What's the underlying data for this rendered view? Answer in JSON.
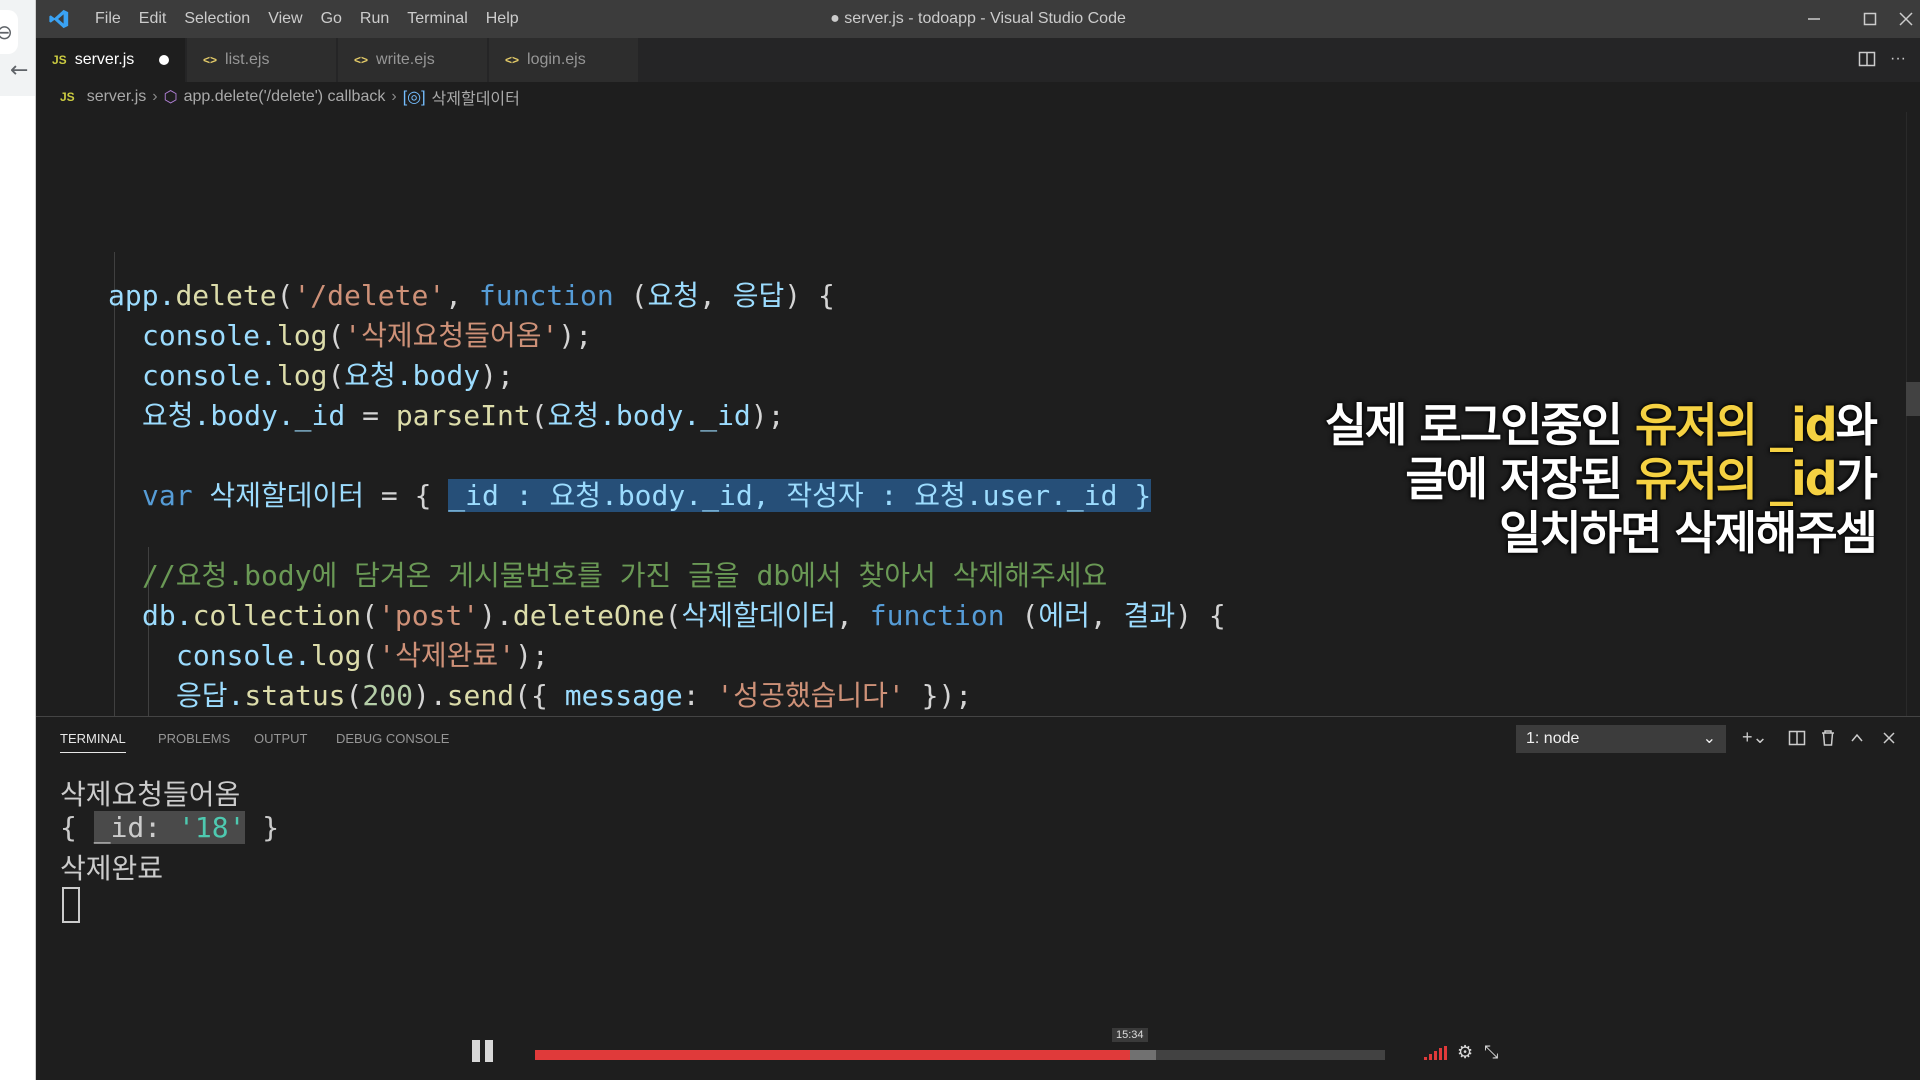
{
  "window": {
    "title": "● server.js - todoapp - Visual Studio Code",
    "menu": [
      "File",
      "Edit",
      "Selection",
      "View",
      "Go",
      "Run",
      "Terminal",
      "Help"
    ]
  },
  "tabs": [
    {
      "label": "server.js",
      "icon": "JS",
      "active": true,
      "dirty": true
    },
    {
      "label": "list.ejs",
      "icon": "<>",
      "active": false
    },
    {
      "label": "write.ejs",
      "icon": "<>",
      "active": false
    },
    {
      "label": "login.ejs",
      "icon": "<>",
      "active": false
    }
  ],
  "breadcrumbs": {
    "file_icon": "JS",
    "file": "server.js",
    "callback": "app.delete('/delete') callback",
    "variable": "삭제할데이터"
  },
  "code": {
    "l1": {
      "a": "app.",
      "b": "delete",
      "c": "(",
      "d": "'/delete'",
      "e": ", ",
      "f": "function",
      "g": " (",
      "h": "요청",
      "i": ", ",
      "j": "응답",
      "k": ") {"
    },
    "l2": {
      "a": "console.",
      "b": "log",
      "c": "(",
      "d": "'삭제요청들어옴'",
      "e": ");"
    },
    "l3": {
      "a": "console.",
      "b": "log",
      "c": "(",
      "d": "요청.body",
      "e": ");"
    },
    "l4": {
      "a": "요청.body._id",
      "b": " = ",
      "c": "parseInt",
      "d": "(",
      "e": "요청.body._id",
      "f": ");"
    },
    "l5": {
      "a": "var",
      "b": " 삭제할데이터",
      "c": " = { ",
      "d": "_id : 요청.body._id, 작성자 : 요청.user._id }"
    },
    "l6": {
      "a": "//요청.body에 담겨온 게시물번호를 가진 글을 db에서 찾아서 삭제해주세요"
    },
    "l7": {
      "a": "db.",
      "b": "collection",
      "c": "(",
      "d": "'post'",
      "e": ").",
      "f": "deleteOne",
      "g": "(",
      "h": "삭제할데이터",
      "i": ", ",
      "j": "function",
      "k": " (",
      "l": "에러",
      "m": ", ",
      "n": "결과",
      "o": ") {"
    },
    "l8": {
      "a": "console.",
      "b": "log",
      "c": "(",
      "d": "'삭제완료'",
      "e": ");"
    },
    "l9": {
      "a": "응답.",
      "b": "status",
      "c": "(",
      "d": "200",
      "e": ").",
      "f": "send",
      "g": "({ ",
      "h": "message",
      "i": ": ",
      "j": "'성공했습니다'",
      "k": " });"
    }
  },
  "caption": {
    "line1_a": "실제 로그인중인 ",
    "line1_hl": "유저의 _id",
    "line1_b": "와",
    "line2_a": "글에 저장된 ",
    "line2_hl": "유저의 _id",
    "line2_b": "가",
    "line3": "일치하면 삭제해주셈",
    "highlight_color": "#f5d142"
  },
  "panel": {
    "tabs": [
      "TERMINAL",
      "PROBLEMS",
      "OUTPUT",
      "DEBUG CONSOLE"
    ],
    "terminal_select": "1: node",
    "output": {
      "line1": "삭제요청들어옴",
      "line2_a": "{ ",
      "line2_key": "_id: ",
      "line2_val": "'18'",
      "line2_b": " }",
      "line3": "삭제완료"
    }
  },
  "video": {
    "time": "15:34",
    "progress": 0.7,
    "buffered": 0.73,
    "accent": "#e03a3a"
  },
  "icons": [
    "vscode-logo-icon",
    "minimize-icon",
    "maximize-icon",
    "close-icon",
    "split-editor-icon",
    "more-actions-icon",
    "new-terminal-icon",
    "split-terminal-icon",
    "trash-icon",
    "maximize-panel-icon",
    "close-panel-icon",
    "pause-icon",
    "volume-icon",
    "gear-icon",
    "fullscreen-icon"
  ]
}
